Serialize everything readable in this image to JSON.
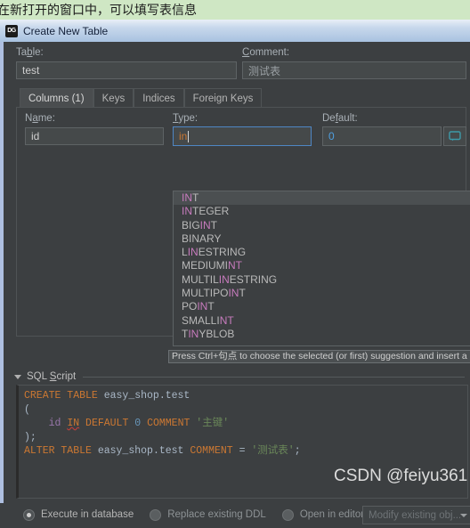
{
  "banner": {
    "text": "在新打开的窗口中，可以填写表信息",
    "bg_color": "#cfe7c4"
  },
  "window": {
    "icon": "datagrip-logo-icon",
    "icon_text": "DG",
    "title": "Create New Table"
  },
  "form": {
    "table_label": "Table:",
    "table_value": "test",
    "comment_label": "Comment:",
    "comment_value": "测试表"
  },
  "tabs": [
    {
      "label": "Columns (1)",
      "active": true
    },
    {
      "label": "Keys",
      "active": false
    },
    {
      "label": "Indices",
      "active": false
    },
    {
      "label": "Foreign Keys",
      "active": false
    }
  ],
  "column_editor": {
    "name_label": "Name:",
    "name_value": "id",
    "type_label": "Type:",
    "type_value": "in",
    "default_label": "Default:",
    "default_value": "0",
    "comment_button_icon": "comment-bubble-icon"
  },
  "autocomplete": {
    "match_prefix_len": 2,
    "highlight_color": "#c77bbd",
    "items": [
      {
        "text": "INT",
        "hl": [
          [
            0,
            2
          ]
        ],
        "selected": true
      },
      {
        "text": "INTEGER",
        "hl": [
          [
            0,
            2
          ]
        ],
        "selected": false
      },
      {
        "text": "BIGINT",
        "hl": [
          [
            3,
            5
          ]
        ],
        "selected": false
      },
      {
        "text": "BINARY",
        "hl": [],
        "selected": false
      },
      {
        "text": "LINESTRING",
        "hl": [
          [
            1,
            3
          ]
        ],
        "selected": false
      },
      {
        "text": "MEDIUMINT",
        "hl": [
          [
            7,
            9
          ]
        ],
        "selected": false
      },
      {
        "text": "MULTILINESTRING",
        "hl": [
          [
            6,
            8
          ]
        ],
        "selected": false
      },
      {
        "text": "MULTIPOINT",
        "hl": [
          [
            7,
            9
          ]
        ],
        "selected": false
      },
      {
        "text": "POINT",
        "hl": [
          [
            2,
            4
          ]
        ],
        "selected": false
      },
      {
        "text": "SMALLINT",
        "hl": [
          [
            6,
            8
          ]
        ],
        "selected": false
      },
      {
        "text": "TINYBLOB",
        "hl": [
          [
            1,
            3
          ]
        ],
        "selected": false
      }
    ],
    "hint": "Press Ctrl+句点 to choose the selected (or first) suggestion and insert a dot af"
  },
  "sql_section": {
    "title": "SQL Script",
    "collapse_icon": "chevron-down-icon",
    "lines": [
      [
        {
          "t": "CREATE TABLE ",
          "c": "kw"
        },
        {
          "t": "easy_shop.test",
          "c": "plain"
        }
      ],
      [
        {
          "t": "(",
          "c": "plain"
        }
      ],
      [
        {
          "t": "    ",
          "c": "plain"
        },
        {
          "t": "id",
          "c": "fld"
        },
        {
          "t": " ",
          "c": "plain"
        },
        {
          "t": "IN",
          "c": "kw err"
        },
        {
          "t": " ",
          "c": "plain"
        },
        {
          "t": "DEFAULT",
          "c": "kw"
        },
        {
          "t": " ",
          "c": "plain"
        },
        {
          "t": "0",
          "c": "num"
        },
        {
          "t": " ",
          "c": "plain"
        },
        {
          "t": "COMMENT",
          "c": "kw"
        },
        {
          "t": " ",
          "c": "plain"
        },
        {
          "t": "'主键'",
          "c": "str"
        }
      ],
      [
        {
          "t": ");",
          "c": "plain"
        }
      ],
      [
        {
          "t": "ALTER TABLE ",
          "c": "kw"
        },
        {
          "t": "easy_shop.test",
          "c": "plain"
        },
        {
          "t": " ",
          "c": "plain"
        },
        {
          "t": "COMMENT",
          "c": "kw"
        },
        {
          "t": " = ",
          "c": "plain"
        },
        {
          "t": "'测试表'",
          "c": "str"
        },
        {
          "t": ";",
          "c": "plain"
        }
      ]
    ]
  },
  "bottom_bar": {
    "options": [
      {
        "label": "Execute in database",
        "selected": true
      },
      {
        "label": "Replace existing DDL",
        "selected": false
      },
      {
        "label": "Open in editor",
        "selected": false
      }
    ],
    "combo_value": "Modify existing obj...",
    "combo_icon": "chevron-down-icon"
  },
  "watermark": {
    "text": "CSDN @feiyu361"
  }
}
